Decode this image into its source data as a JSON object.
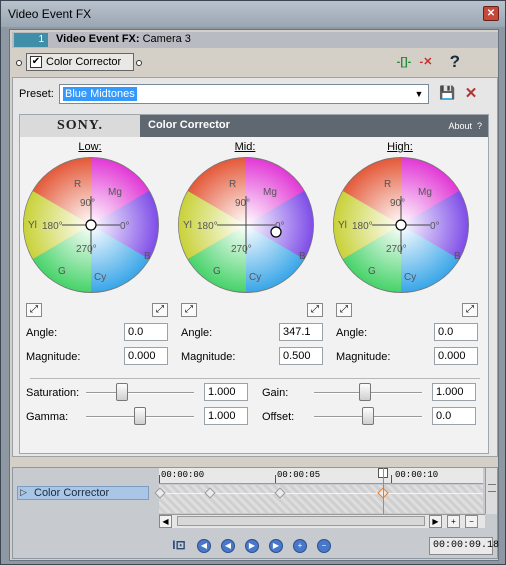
{
  "window": {
    "title": "Video Event FX"
  },
  "chain": {
    "number": "1",
    "label_bold": "Video Event FX:",
    "label_target": "Camera 3"
  },
  "plugin": {
    "name": "Color Corrector",
    "enabled": true
  },
  "preset": {
    "label": "Preset:",
    "value": "Blue Midtones"
  },
  "fx_header": {
    "brand": "SONY.",
    "name": "Color Corrector",
    "about": "About",
    "help": "?"
  },
  "wheels": [
    {
      "title": "Low:",
      "angle_label": "Angle:",
      "angle": "0.0",
      "magnitude_label": "Magnitude:",
      "magnitude": "0.000"
    },
    {
      "title": "Mid:",
      "angle_label": "Angle:",
      "angle": "347.1",
      "magnitude_label": "Magnitude:",
      "magnitude": "0.500"
    },
    {
      "title": "High:",
      "angle_label": "Angle:",
      "angle": "0.0",
      "magnitude_label": "Magnitude:",
      "magnitude": "0.000"
    }
  ],
  "wheel_labels": {
    "r": "R",
    "mg": "Mg",
    "yl": "Yl",
    "b": "B",
    "g": "G",
    "cy": "Cy",
    "d90": "90°",
    "d180": "180°",
    "d0": "0°",
    "d270": "270°"
  },
  "sliders": {
    "saturation": {
      "label": "Saturation:",
      "value": "1.000"
    },
    "gain": {
      "label": "Gain:",
      "value": "1.000"
    },
    "gamma": {
      "label": "Gamma:",
      "value": "1.000"
    },
    "offset": {
      "label": "Offset:",
      "value": "0.0"
    }
  },
  "timeline": {
    "track_label": "Color Corrector",
    "ruler": [
      "00:00:00",
      "00:00:05",
      "00:00:10"
    ],
    "timecode": "00:00:09.18"
  },
  "colors": {
    "accent": "#3f8fa8",
    "selection": "#3399ff",
    "cursor": "#e07b2a"
  }
}
